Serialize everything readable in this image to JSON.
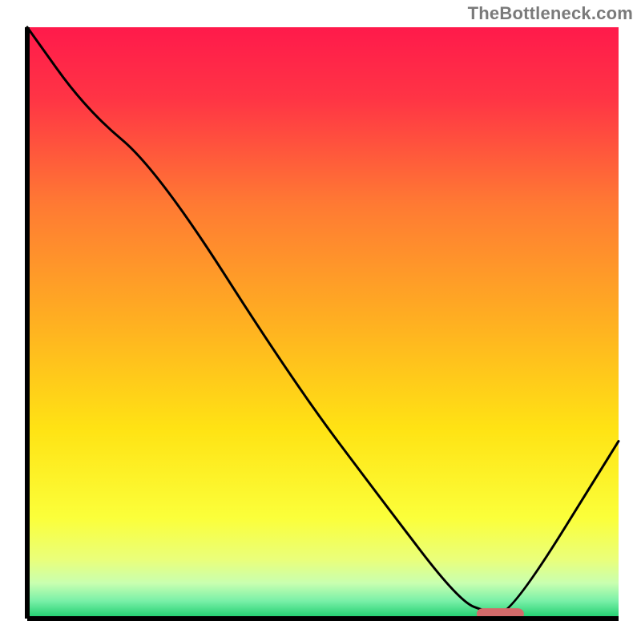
{
  "attribution": "TheBottleneck.com",
  "chart_data": {
    "type": "line",
    "title": "",
    "xlabel": "",
    "ylabel": "",
    "xlim": [
      0,
      100
    ],
    "ylim": [
      0,
      100
    ],
    "grid": false,
    "legend": false,
    "x": [
      0,
      10,
      22,
      45,
      60,
      73,
      78,
      82,
      100
    ],
    "values": [
      100,
      86,
      76,
      40,
      20,
      3,
      1,
      1,
      30
    ],
    "marker": {
      "x_start": 76,
      "x_end": 84,
      "y": 0.8
    },
    "background_gradient_stops": [
      {
        "pos": 0.0,
        "color": "#ff1a4b"
      },
      {
        "pos": 0.12,
        "color": "#ff3445"
      },
      {
        "pos": 0.3,
        "color": "#ff7a33"
      },
      {
        "pos": 0.5,
        "color": "#ffb021"
      },
      {
        "pos": 0.68,
        "color": "#ffe314"
      },
      {
        "pos": 0.83,
        "color": "#fbff3a"
      },
      {
        "pos": 0.9,
        "color": "#eaff7a"
      },
      {
        "pos": 0.94,
        "color": "#c9ffb0"
      },
      {
        "pos": 0.97,
        "color": "#7af0a8"
      },
      {
        "pos": 1.0,
        "color": "#1acc6b"
      }
    ]
  }
}
